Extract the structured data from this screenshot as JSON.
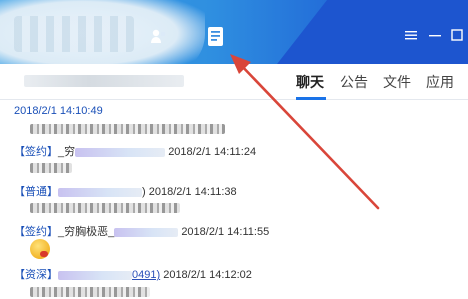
{
  "tabs": [
    {
      "label": "聊天"
    },
    {
      "label": "公告"
    },
    {
      "label": "文件"
    },
    {
      "label": "应用"
    }
  ],
  "messages": {
    "header_time": "2018/2/1 14:10:49",
    "m1": {
      "tag": "【签约】",
      "name_prefix": "_穷",
      "time": "2018/2/1 14:11:24"
    },
    "m2": {
      "tag": "【普通】",
      "name_suffix": ")",
      "time": "2018/2/1 14:11:38"
    },
    "m3": {
      "tag": "【签约】",
      "name": "_穷胸极恶_",
      "time": "2018/2/1 14:11:55"
    },
    "m4": {
      "tag": "【资深】",
      "name_suffix": "0491)",
      "time": "2018/2/1 14:12:02"
    }
  },
  "colors": {
    "titlebar_start": "#3fa2e6",
    "titlebar_end": "#1a4fcc",
    "accent": "#1a73e8",
    "arrow": "#d9463a"
  },
  "icons": {
    "user": "user-icon",
    "doc": "document-icon",
    "menu": "menu-icon",
    "minimize": "minimize-icon"
  }
}
